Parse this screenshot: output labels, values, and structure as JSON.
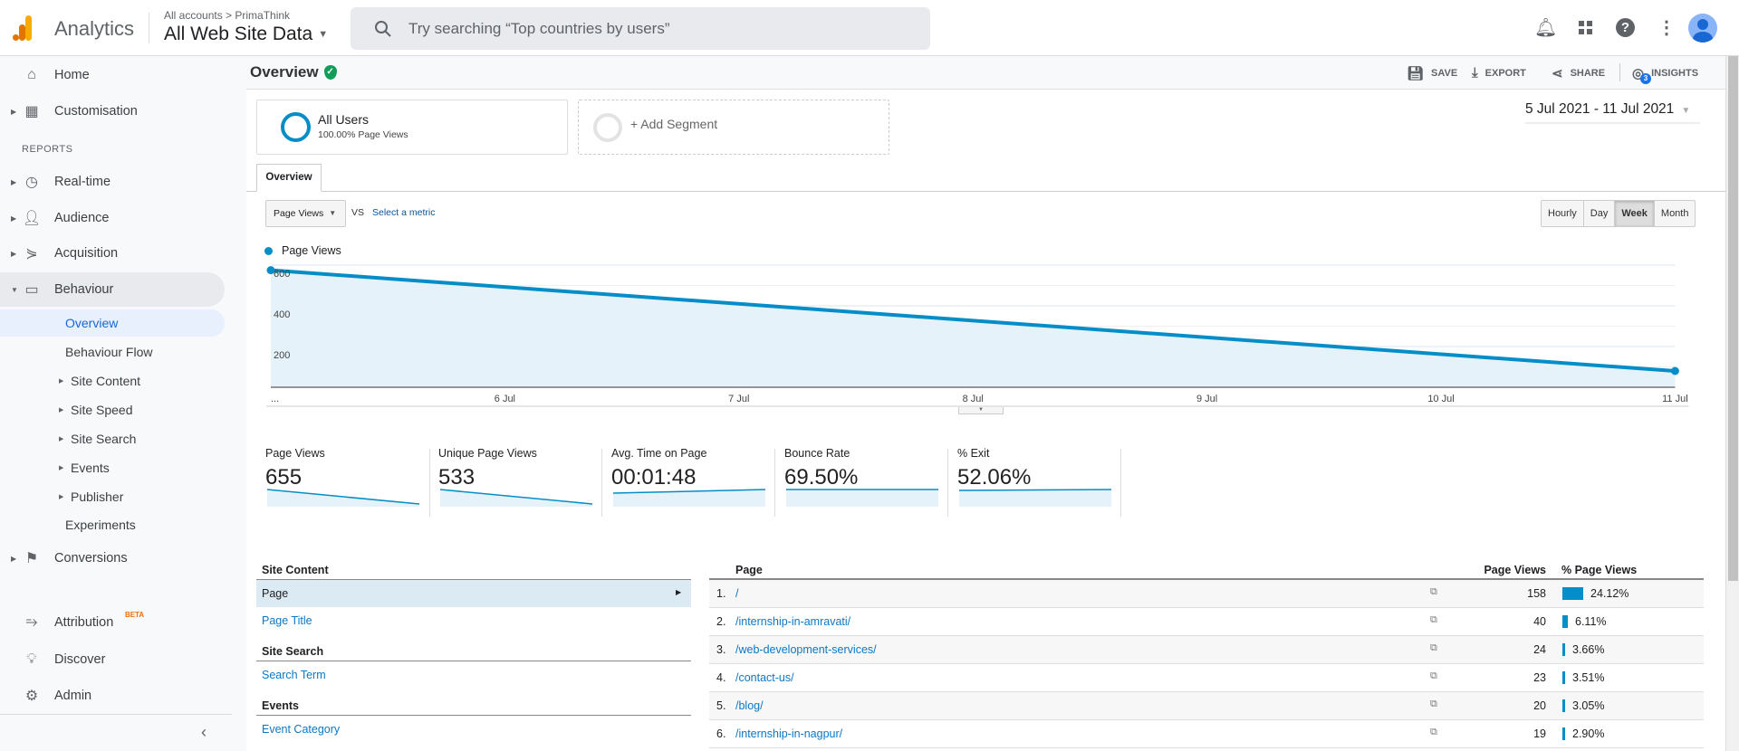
{
  "header": {
    "app_name": "Analytics",
    "breadcrumb": "All accounts > PrimaThink",
    "view_name": "All Web Site Data",
    "search_placeholder": "Try searching “Top countries by users”",
    "brand_colors": [
      "#f9ab00",
      "#e37400"
    ]
  },
  "sidebar": {
    "items": [
      {
        "label": "Home",
        "icon": "home-icon"
      },
      {
        "label": "Customisation",
        "icon": "dashboard-icon"
      },
      {
        "label": "Real-time",
        "icon": "clock-icon"
      },
      {
        "label": "Audience",
        "icon": "person-icon"
      },
      {
        "label": "Acquisition",
        "icon": "acquisition-icon"
      },
      {
        "label": "Behaviour",
        "icon": "behaviour-icon"
      },
      {
        "label": "Conversions",
        "icon": "flag-icon"
      },
      {
        "label": "Attribution",
        "icon": "attribution-icon",
        "badge": "BETA"
      },
      {
        "label": "Discover",
        "icon": "lightbulb-icon"
      },
      {
        "label": "Admin",
        "icon": "gear-icon"
      }
    ],
    "section_label": "REPORTS",
    "behaviour_sub": [
      "Overview",
      "Behaviour Flow",
      "Site Content",
      "Site Speed",
      "Site Search",
      "Events",
      "Publisher",
      "Experiments"
    ]
  },
  "titlebar": {
    "title": "Overview",
    "actions": [
      "SAVE",
      "EXPORT",
      "SHARE",
      "INSIGHTS"
    ],
    "insights_badge": "3"
  },
  "segments": {
    "all_users": "All Users",
    "all_users_sub": "100.00% Page Views",
    "add": "+ Add Segment"
  },
  "date_range": "5 Jul 2021 - 11 Jul 2021",
  "tab": "Overview",
  "metric_select": {
    "value": "Page Views",
    "vs": "VS",
    "select": "Select a metric"
  },
  "granularity": {
    "options": [
      "Hourly",
      "Day",
      "Week",
      "Month"
    ],
    "selected": "Week"
  },
  "chart_data": {
    "type": "area",
    "legend": "Page Views",
    "color": "#058dc7",
    "x_ticks": [
      "...",
      "6 Jul",
      "7 Jul",
      "8 Jul",
      "9 Jul",
      "10 Jul",
      "11 Jul"
    ],
    "y_ticks": [
      "600",
      "400",
      "200"
    ],
    "ylim": [
      0,
      600
    ],
    "points": [
      {
        "x": "5 Jul",
        "y": 575
      },
      {
        "x": "11 Jul",
        "y": 80
      }
    ],
    "grid": true
  },
  "scorecards": [
    {
      "label": "Page Views",
      "value": "655"
    },
    {
      "label": "Unique Page Views",
      "value": "533"
    },
    {
      "label": "Avg. Time on Page",
      "value": "00:01:48"
    },
    {
      "label": "Bounce Rate",
      "value": "69.50%"
    },
    {
      "label": "% Exit",
      "value": "52.06%"
    }
  ],
  "left_panel": {
    "site_content": "Site Content",
    "page": "Page",
    "page_title": "Page Title",
    "site_search": "Site Search",
    "search_term": "Search Term",
    "events": "Events",
    "event_category": "Event Category"
  },
  "table": {
    "headers": {
      "page": "Page",
      "views": "Page Views",
      "pct": "% Page Views"
    },
    "rows": [
      {
        "n": "1.",
        "page": "/",
        "views": "158",
        "pct": "24.12%",
        "frac": 0.2412
      },
      {
        "n": "2.",
        "page": "/internship-in-amravati/",
        "views": "40",
        "pct": "6.11%",
        "frac": 0.0611
      },
      {
        "n": "3.",
        "page": "/web-development-services/",
        "views": "24",
        "pct": "3.66%",
        "frac": 0.0366
      },
      {
        "n": "4.",
        "page": "/contact-us/",
        "views": "23",
        "pct": "3.51%",
        "frac": 0.0351
      },
      {
        "n": "5.",
        "page": "/blog/",
        "views": "20",
        "pct": "3.05%",
        "frac": 0.0305
      },
      {
        "n": "6.",
        "page": "/internship-in-nagpur/",
        "views": "19",
        "pct": "2.90%",
        "frac": 0.029
      }
    ]
  }
}
